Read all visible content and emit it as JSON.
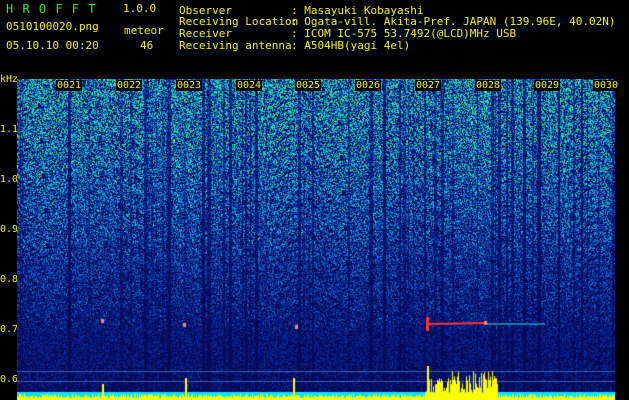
{
  "header": {
    "logo": "H R O F F T",
    "version": "1.0.0",
    "filename": "0510100020.png",
    "meteor_label": "meteor",
    "meteor_count": "46",
    "datetime": "05.10.10 00:20",
    "fields": [
      {
        "label": "Observer",
        "value": ": Masayuki Kobayashi"
      },
      {
        "label": "Receiving Location",
        "value": ": Ogata-vill. Akita-Pref. JAPAN (139.96E, 40.02N)"
      },
      {
        "label": "Receiver",
        "value": ": ICOM IC-575 53.7492(@LCD)MHz USB"
      },
      {
        "label": "Receiving antenna",
        "value": ": A504HB(yagi 4el)"
      }
    ]
  },
  "spectrogram": {
    "unit": "kHz",
    "y_ticks": [
      "1.1",
      "1.0",
      "0.9",
      "0.8",
      "0.7",
      "0.6"
    ],
    "time_ticks": [
      "0021",
      "0022",
      "0023",
      "0024",
      "0025",
      "0026",
      "0027",
      "0028",
      "0029",
      "0030"
    ],
    "colors": {
      "text": "#f2f21e",
      "label": "#2ee64a",
      "trace": "#ff3333",
      "baseline": "#00e5ff",
      "level": "#ffff00"
    }
  }
}
